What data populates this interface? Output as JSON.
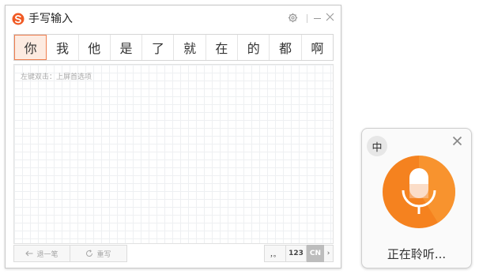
{
  "handwriting": {
    "title": "手写输入",
    "candidates": [
      "你",
      "我",
      "他",
      "是",
      "了",
      "就",
      "在",
      "的",
      "都",
      "啊"
    ],
    "hint": "左键双击：上屏首选项",
    "undo_label": "退一笔",
    "rewrite_label": "重写",
    "punct_label": "，。",
    "num_label": "123",
    "cn_label": "CN",
    "more_label": "›"
  },
  "voice": {
    "lang_label": "中",
    "status": "正在聆听...",
    "accent_color": "#f5821f"
  },
  "colors": {
    "brand": "#f05a24",
    "candidate_selected_bg": "#fdebe1",
    "candidate_selected_border": "#f07f4f"
  }
}
